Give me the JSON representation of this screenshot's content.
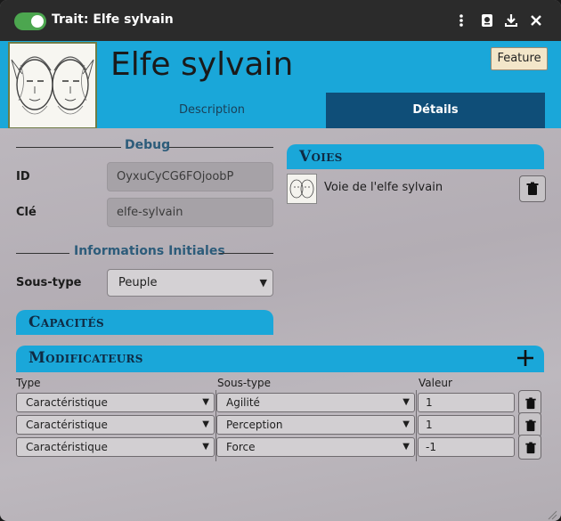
{
  "window": {
    "title": "Trait: Elfe sylvain",
    "toggle_on": true,
    "icons": [
      "more-vertical-icon",
      "journal-icon",
      "download-icon",
      "close-icon"
    ]
  },
  "header": {
    "name": "Elfe sylvain",
    "badge": "Feature",
    "tabs": [
      {
        "label": "Description",
        "active": false
      },
      {
        "label": "Détails",
        "active": true
      }
    ]
  },
  "debug": {
    "legend": "Debug",
    "id_label": "ID",
    "id_value": "OyxuCyCG6FOjoobP",
    "key_label": "Clé",
    "key_value": "elfe-sylvain"
  },
  "initial_info": {
    "legend": "Informations Initiales",
    "subtype_label": "Sous-type",
    "subtype_value": "Peuple"
  },
  "capacites": {
    "title": "Capacités"
  },
  "voies": {
    "title": "Voies",
    "items": [
      {
        "label": "Voie de l'elfe sylvain"
      }
    ]
  },
  "modificateurs": {
    "title": "Modificateurs",
    "columns": [
      "Type",
      "Sous-type",
      "Valeur"
    ],
    "rows": [
      {
        "type": "Caractéristique",
        "subtype": "Agilité",
        "value": "1"
      },
      {
        "type": "Caractéristique",
        "subtype": "Perception",
        "value": "1"
      },
      {
        "type": "Caractéristique",
        "subtype": "Force",
        "value": "-1"
      }
    ]
  },
  "colors": {
    "accent": "#1aa7d9",
    "tab_active": "#0f4e78",
    "titlebar": "#2b2b2b",
    "toggle": "#4ca64f"
  }
}
